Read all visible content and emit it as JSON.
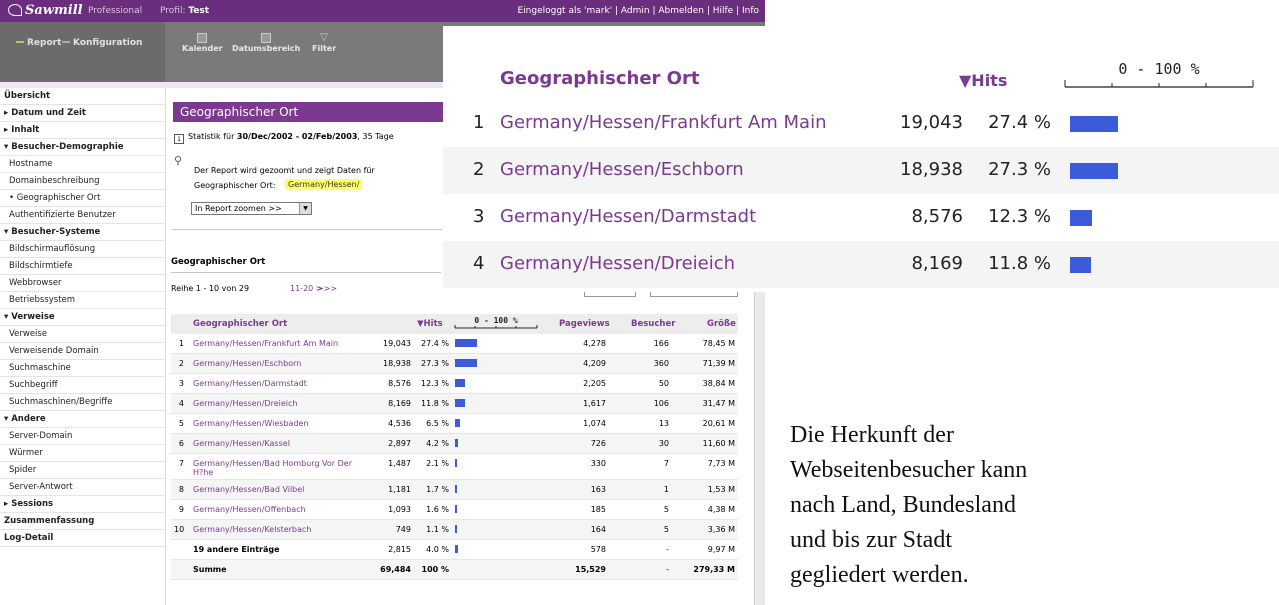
{
  "topbar": {
    "brand": "Sawmill",
    "edition": "Professional",
    "profile_label": "Profil:",
    "profile_name": "Test",
    "user_links": "Eingeloggt als 'mark' | Admin | Abmelden | Hilfe | Info"
  },
  "nav_tabs": {
    "report": "Report",
    "config": "Konfiguration"
  },
  "toolbar": {
    "calendar": "Kalender",
    "date_range": "Datumsbereich",
    "filter": "Filter"
  },
  "sidebar": {
    "items": [
      {
        "label": "Übersicht",
        "level": 1
      },
      {
        "label": "▸ Datum und Zeit",
        "level": 1
      },
      {
        "label": "▸ Inhalt",
        "level": 1
      },
      {
        "label": "▾ Besucher-Demographie",
        "level": 1
      },
      {
        "label": "Hostname",
        "level": 2
      },
      {
        "label": "Domainbeschreibung",
        "level": 2
      },
      {
        "label": "• Geographischer Ort",
        "level": 2
      },
      {
        "label": "Authentifizierte Benutzer",
        "level": 2
      },
      {
        "label": "▾ Besucher-Systeme",
        "level": 1
      },
      {
        "label": "Bildschirmauflösung",
        "level": 2
      },
      {
        "label": "Bildschirmtiefe",
        "level": 2
      },
      {
        "label": "Webbrowser",
        "level": 2
      },
      {
        "label": "Betriebssystem",
        "level": 2
      },
      {
        "label": "▾ Verweise",
        "level": 1
      },
      {
        "label": "Verweise",
        "level": 2
      },
      {
        "label": "Verweisende Domain",
        "level": 2
      },
      {
        "label": "Suchmaschine",
        "level": 2
      },
      {
        "label": "Suchbegriff",
        "level": 2
      },
      {
        "label": "Suchmaschinen/Begriffe",
        "level": 2
      },
      {
        "label": "▾ Andere",
        "level": 1
      },
      {
        "label": "Server-Domain",
        "level": 2
      },
      {
        "label": "Würmer",
        "level": 2
      },
      {
        "label": "Spider",
        "level": 2
      },
      {
        "label": "Server-Antwort",
        "level": 2
      },
      {
        "label": "▸ Sessions",
        "level": 1
      },
      {
        "label": "Zusammenfassung",
        "level": 1
      },
      {
        "label": "Log-Detail",
        "level": 1
      }
    ]
  },
  "report": {
    "title": "Geographischer Ort",
    "period_prefix": "Statistik für ",
    "period_range": "30/Dec/2002 - 02/Feb/2003",
    "period_suffix": ", 35 Tage",
    "zoom_text": "Der Report wird gezoomt und zeigt Daten für",
    "zoom_label": "Geographischer Ort:",
    "zoom_value": "Germany/Hessen/",
    "zoom_select": "In Report zoomen >>",
    "section_title": "Geographischer Ort",
    "rows_info": "Reihe 1 - 10 von 29",
    "rows_next": "11-20 >",
    "rows_last": ">>>"
  },
  "table": {
    "headers": {
      "ort": "Geographischer Ort",
      "hits": "▼Hits",
      "scale": "0 - 100 %",
      "pageviews": "Pageviews",
      "besucher": "Besucher",
      "groesse": "Größe"
    },
    "rows": [
      {
        "rank": "1",
        "ort": "Germany/Hessen/Frankfurt Am Main",
        "hits": "19,043",
        "pct": "27.4 %",
        "pct_value": 27.4,
        "pageviews": "4,278",
        "besucher": "166",
        "groesse": "78,45 M"
      },
      {
        "rank": "2",
        "ort": "Germany/Hessen/Eschborn",
        "hits": "18,938",
        "pct": "27.3 %",
        "pct_value": 27.3,
        "pageviews": "4,209",
        "besucher": "360",
        "groesse": "71,39 M"
      },
      {
        "rank": "3",
        "ort": "Germany/Hessen/Darmstadt",
        "hits": "8,576",
        "pct": "12.3 %",
        "pct_value": 12.3,
        "pageviews": "2,205",
        "besucher": "50",
        "groesse": "38,84 M"
      },
      {
        "rank": "4",
        "ort": "Germany/Hessen/Dreieich",
        "hits": "8,169",
        "pct": "11.8 %",
        "pct_value": 11.8,
        "pageviews": "1,617",
        "besucher": "106",
        "groesse": "31,47 M"
      },
      {
        "rank": "5",
        "ort": "Germany/Hessen/Wiesbaden",
        "hits": "4,536",
        "pct": "6.5 %",
        "pct_value": 6.5,
        "pageviews": "1,074",
        "besucher": "13",
        "groesse": "20,61 M"
      },
      {
        "rank": "6",
        "ort": "Germany/Hessen/Kassel",
        "hits": "2,897",
        "pct": "4.2 %",
        "pct_value": 4.2,
        "pageviews": "726",
        "besucher": "30",
        "groesse": "11,60 M"
      },
      {
        "rank": "7",
        "ort": "Germany/Hessen/Bad Homburg Vor Der",
        "ort2": "H?he",
        "hits": "1,487",
        "pct": "2.1 %",
        "pct_value": 2.1,
        "pageviews": "330",
        "besucher": "7",
        "groesse": "7,73 M"
      },
      {
        "rank": "8",
        "ort": "Germany/Hessen/Bad Vilbel",
        "hits": "1,181",
        "pct": "1.7 %",
        "pct_value": 1.7,
        "pageviews": "163",
        "besucher": "1",
        "groesse": "1,53 M"
      },
      {
        "rank": "9",
        "ort": "Germany/Hessen/Offenbach",
        "hits": "1,093",
        "pct": "1.6 %",
        "pct_value": 1.6,
        "pageviews": "185",
        "besucher": "5",
        "groesse": "4,38 M"
      },
      {
        "rank": "10",
        "ort": "Germany/Hessen/Kelsterbach",
        "hits": "749",
        "pct": "1.1 %",
        "pct_value": 1.1,
        "pageviews": "164",
        "besucher": "5",
        "groesse": "3,36 M"
      }
    ],
    "others": {
      "label": "19 andere Einträge",
      "hits": "2,815",
      "pct": "4.0 %",
      "pct_value": 4.0,
      "pageviews": "578",
      "besucher": "-",
      "groesse": "9,97 M"
    },
    "total": {
      "label": "Summe",
      "hits": "69,484",
      "pct": "100 %",
      "pageviews": "15,529",
      "besucher": "-",
      "groesse": "279,33 M"
    }
  },
  "overlay": {
    "col_ort": "Geographischer Ort",
    "col_hits": "▼Hits",
    "scale": "0 - 100 %",
    "rows": [
      {
        "rank": "1",
        "ort": "Germany/Hessen/Frankfurt Am Main",
        "hits": "19,043",
        "pct": "27.4 %",
        "pct_value": 27.4
      },
      {
        "rank": "2",
        "ort": "Germany/Hessen/Eschborn",
        "hits": "18,938",
        "pct": "27.3 %",
        "pct_value": 27.3
      },
      {
        "rank": "3",
        "ort": "Germany/Hessen/Darmstadt",
        "hits": "8,576",
        "pct": "12.3 %",
        "pct_value": 12.3
      },
      {
        "rank": "4",
        "ort": "Germany/Hessen/Dreieich",
        "hits": "8,169",
        "pct": "11.8 %",
        "pct_value": 11.8
      }
    ]
  },
  "caption": {
    "lines": [
      "Die Herkunft der",
      "Webseitenbesucher kann",
      "nach Land, Bundesland",
      "und bis zur Stadt",
      "gegliedert werden."
    ]
  },
  "colors": {
    "brand_purple": "#6b2d7d",
    "link_purple": "#7b3a8f",
    "bar_blue": "#3b5bdb"
  }
}
